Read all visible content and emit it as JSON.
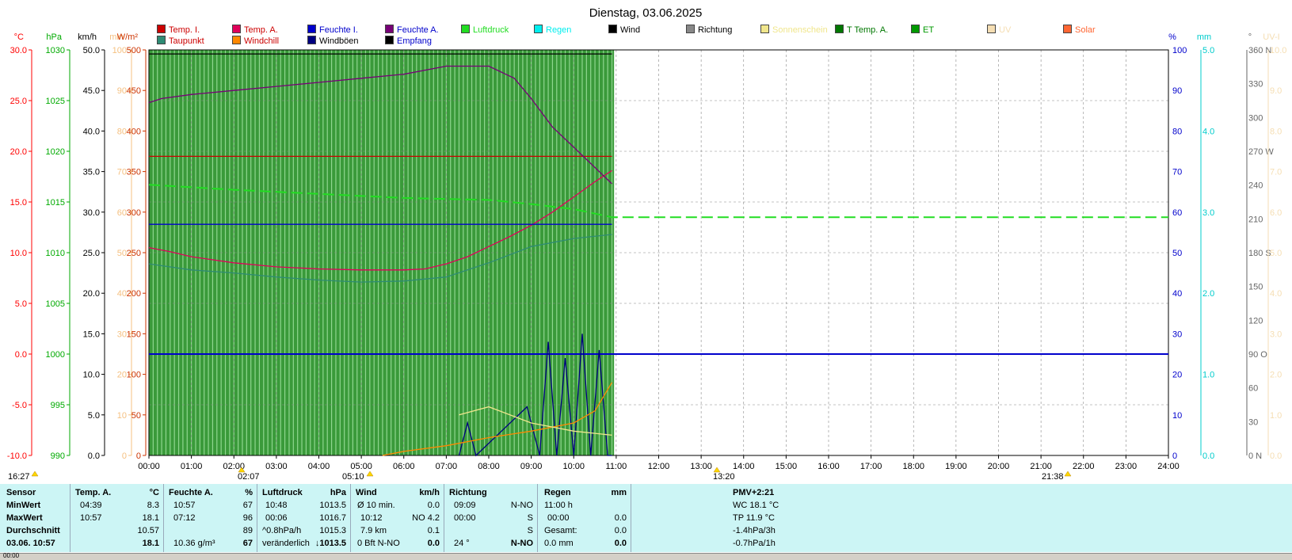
{
  "title": "Dienstag, 03.06.2025",
  "colors": {
    "temp_i": "#cc0000",
    "temp_a": "#e0005a",
    "feuchte_i": "#0000cc",
    "feuchte_a": "#770077",
    "taupunkt": "#2e8b74",
    "windchill": "#ff8800",
    "windboeen": "#000080",
    "empfang": "#000000",
    "luftdruck": "#22dd22",
    "regen": "#00eeee",
    "wind": "#000000",
    "richtung": "#888888",
    "sonnenschein": "#f0e68c",
    "t_temp_a": "#007700",
    "et": "#009900",
    "uv": "#f5deb3",
    "solar": "#ff6633"
  },
  "legend": [
    {
      "label": "Temp. I.",
      "color": "#cc0000"
    },
    {
      "label": "Taupunkt",
      "color": "#2e8b74"
    },
    {
      "label": "Temp. A.",
      "color": "#e0005a"
    },
    {
      "label": "Windchill",
      "color": "#ff8800"
    },
    {
      "label": "Feuchte I.",
      "color": "#0000cc"
    },
    {
      "label": "Windböen",
      "color": "#000080"
    },
    {
      "label": "Feuchte A.",
      "color": "#770077"
    },
    {
      "label": "Empfang",
      "color": "#000000"
    },
    {
      "label": "Luftdruck",
      "color": "#22dd22"
    },
    {
      "label": "Regen",
      "color": "#00eeee"
    },
    {
      "label": "Wind",
      "color": "#000000"
    },
    {
      "label": "Richtung",
      "color": "#888888"
    },
    {
      "label": "Sonnenschein",
      "color": "#f0e68c"
    },
    {
      "label": "T Temp. A.",
      "color": "#007700"
    },
    {
      "label": "ET",
      "color": "#009900"
    },
    {
      "label": "UV",
      "color": "#f5deb3"
    },
    {
      "label": "Solar",
      "color": "#ff6633"
    }
  ],
  "chart_data": {
    "type": "line",
    "title": "Dienstag, 03.06.2025",
    "x_ticks": [
      "00:00",
      "01:00",
      "02:00",
      "03:00",
      "04:00",
      "05:00",
      "06:00",
      "07:00",
      "08:00",
      "09:00",
      "10:00",
      "11:00",
      "12:00",
      "13:00",
      "14:00",
      "15:00",
      "16:00",
      "17:00",
      "18:00",
      "19:00",
      "20:00",
      "21:00",
      "22:00",
      "23:00",
      "24:00"
    ],
    "xlim": [
      0,
      24
    ],
    "grid": true,
    "left_axes": [
      {
        "unit": "°C",
        "color": "#ff0000",
        "ticks": [
          "30.0",
          "25.0",
          "20.0",
          "15.0",
          "10.0",
          "5.0",
          "0.0",
          "-5.0",
          "-10.0"
        ],
        "ylim": [
          -10,
          30
        ]
      },
      {
        "unit": "hPa",
        "color": "#00aa00",
        "ticks": [
          "1030",
          "1025",
          "1020",
          "1015",
          "1010",
          "1005",
          "1000",
          "995",
          "990"
        ],
        "ylim": [
          990,
          1030
        ]
      },
      {
        "unit": "km/h",
        "color": "#000000",
        "ticks": [
          "50.0",
          "45.0",
          "40.0",
          "35.0",
          "30.0",
          "25.0",
          "20.0",
          "15.0",
          "10.0",
          "5.0",
          "0.0"
        ],
        "ylim": [
          0,
          50
        ]
      },
      {
        "unit": "min",
        "color": "#f5c080",
        "ticks": [
          "100",
          "90",
          "80",
          "70",
          "60",
          "50",
          "40",
          "30",
          "20",
          "10",
          "0"
        ],
        "ylim": [
          0,
          100
        ]
      },
      {
        "unit": "W/m²",
        "color": "#cc3300",
        "ticks": [
          "500",
          "450",
          "400",
          "350",
          "300",
          "250",
          "200",
          "150",
          "100",
          "50",
          "0"
        ],
        "ylim": [
          0,
          500
        ]
      }
    ],
    "right_axes": [
      {
        "unit": "%",
        "color": "#0000cc",
        "ticks": [
          "100",
          "90",
          "80",
          "70",
          "60",
          "50",
          "40",
          "30",
          "20",
          "10",
          "0"
        ],
        "ylim": [
          0,
          100
        ]
      },
      {
        "unit": "mm",
        "color": "#00cccc",
        "ticks": [
          "5.0",
          "4.0",
          "3.0",
          "2.0",
          "1.0",
          "0.0"
        ],
        "ylim": [
          0,
          5
        ]
      },
      {
        "unit": "°",
        "color": "#666666",
        "ticks": [
          "360 N",
          "330",
          "300",
          "270 W",
          "240",
          "210",
          "180 S",
          "150",
          "120",
          "90 O",
          "60",
          "30",
          "0 N"
        ],
        "ylim": [
          0,
          360
        ]
      },
      {
        "unit": "UV-I",
        "color": "#f5deb3",
        "ticks": [
          "10.0",
          "9.0",
          "8.0",
          "7.0",
          "6.0",
          "5.0",
          "4.0",
          "3.0",
          "2.0",
          "1.0",
          "0.0"
        ],
        "ylim": [
          0,
          10
        ]
      }
    ],
    "series": [
      {
        "name": "Temp. I.",
        "axis": "°C",
        "x": [
          0,
          10.9
        ],
        "y": [
          19.5,
          19.5
        ]
      },
      {
        "name": "Temp. A.",
        "axis": "°C",
        "x": [
          0,
          0.5,
          1,
          2,
          3,
          4,
          5,
          5.5,
          6,
          6.5,
          7,
          7.5,
          8,
          8.5,
          9,
          9.5,
          10,
          10.5,
          10.9
        ],
        "y": [
          10.5,
          10.1,
          9.6,
          9.0,
          8.6,
          8.4,
          8.3,
          8.3,
          8.3,
          8.4,
          8.9,
          9.6,
          10.6,
          11.6,
          12.7,
          14.0,
          15.5,
          17.0,
          18.1
        ]
      },
      {
        "name": "Taupunkt",
        "axis": "°C",
        "x": [
          0,
          1,
          2,
          3,
          4,
          5,
          6,
          7,
          8,
          9,
          10,
          10.9
        ],
        "y": [
          8.9,
          8.3,
          8.0,
          7.6,
          7.3,
          7.1,
          7.2,
          7.6,
          9.0,
          10.6,
          11.4,
          11.8
        ]
      },
      {
        "name": "Luftdruck",
        "axis": "hPa",
        "x": [
          0,
          2,
          4,
          6,
          8,
          9,
          10,
          10.9,
          24
        ],
        "y": [
          1016.7,
          1016.2,
          1015.8,
          1015.4,
          1015.2,
          1014.8,
          1014.3,
          1013.5,
          1013.5
        ]
      },
      {
        "name": "Feuchte I.",
        "axis": "%",
        "x": [
          0,
          10.9
        ],
        "y": [
          57,
          57
        ]
      },
      {
        "name": "Feuchte A.",
        "axis": "%",
        "x": [
          0,
          0.3,
          1,
          2,
          3,
          4,
          5,
          6,
          7,
          8,
          8.6,
          9,
          9.5,
          10,
          10.5,
          10.9
        ],
        "y": [
          87,
          88,
          89,
          90,
          91,
          92,
          93,
          94,
          96,
          96,
          93,
          88,
          81,
          76,
          71,
          67
        ]
      },
      {
        "name": "Empfang",
        "axis": "%",
        "x": [
          0,
          10.9
        ],
        "y": [
          99,
          99
        ]
      },
      {
        "name": "Wind",
        "axis": "km/h",
        "x": [
          0,
          24
        ],
        "y": [
          12.5,
          12.5
        ]
      },
      {
        "name": "Windböen",
        "axis": "km/h",
        "x": [
          7.3,
          7.5,
          7.7,
          8.9,
          9.2,
          9.4,
          9.6,
          9.8,
          10.0,
          10.2,
          10.4,
          10.6,
          10.8,
          10.9
        ],
        "y": [
          0,
          4,
          0,
          6,
          0,
          14,
          0,
          12,
          0,
          15,
          0,
          13,
          0,
          0
        ]
      },
      {
        "name": "Solar",
        "axis": "W/m²",
        "x": [
          5.5,
          6,
          7,
          8,
          9,
          10,
          10.5,
          10.9
        ],
        "y": [
          0,
          5,
          12,
          22,
          30,
          40,
          55,
          90
        ]
      },
      {
        "name": "Windchill",
        "axis": "°C",
        "x": [
          0,
          10.9
        ],
        "y": [
          10.5,
          18.1
        ]
      },
      {
        "name": "Sonnenschein",
        "axis": "min",
        "x": [
          7.3,
          8,
          9,
          10,
          10.9
        ],
        "y": [
          10,
          12,
          8,
          6,
          5
        ]
      }
    ]
  },
  "markers": {
    "sunrise_label": "16:27",
    "label_2": "02:07",
    "label_3": "05:10",
    "label_4": "13:20",
    "label_5": "21:38"
  },
  "stats": {
    "sensor": {
      "h": "Sensor",
      "r1": "MinWert",
      "r2": "MaxWert",
      "r3": "Durchschnitt",
      "r4": "03.06. 10:57"
    },
    "temp": {
      "h": "Temp. A.",
      "unit": "°C",
      "r1t": "04:39",
      "r1v": "8.3",
      "r2t": "10:57",
      "r2v": "18.1",
      "r3v": "10.57",
      "r4v": "18.1"
    },
    "feuchte": {
      "h": "Feuchte A.",
      "unit": "%",
      "r1t": "10:57",
      "r1v": "67",
      "r2t": "07:12",
      "r2v": "96",
      "r3v": "89",
      "r4t": "10.36 g/m³",
      "r4v": "67"
    },
    "luft": {
      "h": "Luftdruck",
      "unit": "hPa",
      "r1t": "10:48",
      "r1v": "1013.5",
      "r2t": "00:06",
      "r2v": "1016.7",
      "r3t": "^0.8hPa/h",
      "r3v": "1015.3",
      "r4t": "veränderlich",
      "r4v": "↓1013.5"
    },
    "wind": {
      "h": "Wind",
      "unit": "km/h",
      "r1t": "Ø 10 min.",
      "r1v": "0.0",
      "r2t": "10:12",
      "r2m": "NO 4.2",
      "r3t": "7.9 km",
      "r3v": "0.1",
      "r4t": "0 Bft N-NO",
      "r4v": "0.0"
    },
    "richtung": {
      "h": "Richtung",
      "r1t": "09:09",
      "r1v": "N-NO",
      "r2t": "00:00",
      "r2v": "S",
      "r3v": "S",
      "r4t": "24 °",
      "r4v": "N-NO"
    },
    "regen": {
      "h": "Regen",
      "unit": "mm",
      "r1t": "11:00 h",
      "r2t": "00:00",
      "r2v": "0.0",
      "r3t": "Gesamt:",
      "r3v": "0.0",
      "r4t": "0.0 mm",
      "r4v": "0.0"
    },
    "pmv": {
      "r0": "PMV+2:21",
      "r1": "WC 18.1 °C",
      "r2": "TP 11.9 °C",
      "r3": "-1.4hPa/3h",
      "r4": "-0.7hPa/1h"
    }
  },
  "statusbar": {
    "left": "00:00"
  }
}
